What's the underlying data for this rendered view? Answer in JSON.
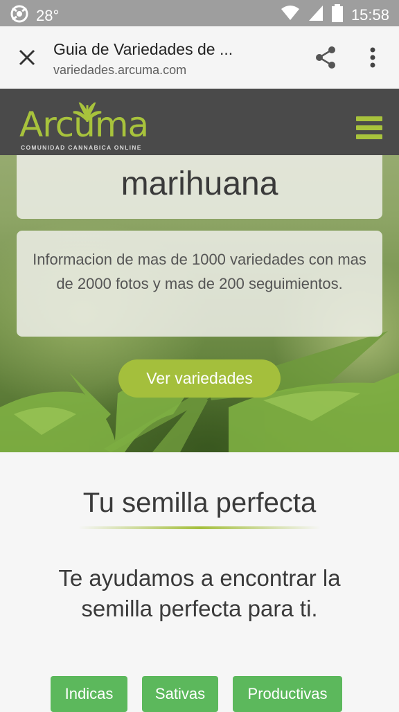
{
  "status_bar": {
    "temperature": "28°",
    "time": "15:58",
    "icons": [
      "avast-icon",
      "wifi-icon",
      "signal-icon",
      "battery-icon"
    ]
  },
  "browser": {
    "title": "Guia de Variedades de ...",
    "url": "variedades.arcuma.com",
    "icons": [
      "close-icon",
      "share-icon",
      "more-vert-icon"
    ]
  },
  "site": {
    "logo_text": "Arcuma",
    "logo_tagline": "COMUNIDAD CANNABICA ONLINE",
    "menu_icon": "hamburger-menu-icon",
    "accent_color": "#a4bf3c"
  },
  "hero": {
    "title": "marihuana",
    "description": "Informacion de mas de 1000 variedades con mas de 2000 fotos y mas de 200 seguimientos.",
    "button_label": "Ver variedades"
  },
  "section": {
    "title": "Tu semilla perfecta",
    "subtitle": "Te ayudamos a encontrar la semilla perfecta para ti.",
    "filters": [
      "Indicas",
      "Sativas",
      "Productivas"
    ],
    "filter_color": "#5cb85c"
  }
}
